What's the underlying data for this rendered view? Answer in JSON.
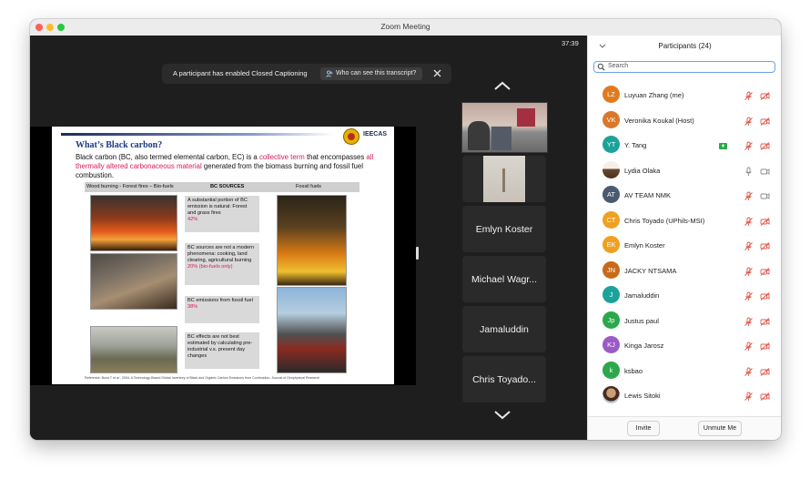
{
  "window": {
    "title": "Zoom Meeting"
  },
  "meeting": {
    "timer": "37:39",
    "cc_banner": {
      "text": "A participant has enabled Closed Captioning",
      "button_label": "Who can see this transcript?"
    }
  },
  "slide": {
    "org": "IEECAS",
    "heading": "What’s Black carbon?",
    "body_part1": "Black carbon (BC, also termed elemental carbon, EC) is a ",
    "body_hl1": "collective term",
    "body_part2": " that encompasses ",
    "body_hl2": "all thermally altered carbonaceous material",
    "body_part3": " generated from the biomass burning and fossil fuel combustion.",
    "table_headers": [
      "Wood burning - Forest fires – Bio-fuels",
      "BC SOURCES",
      "Fossil fuels"
    ],
    "boxes": [
      {
        "text": "A substantial portion of BC emission is natural: Forest and grass fires",
        "pct": "42%"
      },
      {
        "text": "BC sources are not a modern phenomena: cooking, land clearing, agricultural burning",
        "pct": "20% (bio-fuels only)"
      },
      {
        "text": "BC emissions from fossil fuel",
        "pct": "38%"
      },
      {
        "text": "BC effects are not best estimated by calculating pre-industrial v.s. present day changes",
        "pct": ""
      }
    ],
    "reference": "Reference: Bond T et al., 2004: A Technology-Based Global Inventory of Black and Organic Carbon Emissions from Combustion, Journal of Geophysical Research"
  },
  "tiles": [
    "Emlyn Koster",
    "Michael Wagr...",
    "Jamaluddin",
    "Chris Toyado..."
  ],
  "participants_panel": {
    "title": "Participants (24)",
    "search_placeholder": "Search",
    "participants": [
      {
        "initials": "LZ",
        "name": "Luyuan Zhang (me)",
        "color": "#e07a1f",
        "mic": "mic-muted-icon",
        "video": "video-off-icon"
      },
      {
        "initials": "VK",
        "name": "Veronika Koukal (Host)",
        "color": "#d9782a",
        "mic": "mic-muted-icon",
        "video": "video-off-icon"
      },
      {
        "initials": "YT",
        "name": "Y. Tang",
        "color": "#1aa39a",
        "mic": "mic-muted-icon",
        "video": "video-off-icon"
      },
      {
        "initials": "",
        "name": "Lydia Olaka",
        "color": "#8a6a50",
        "mic": "mic-on-icon",
        "video": "video-on-icon"
      },
      {
        "initials": "AT",
        "name": "AV TEAM NMK",
        "color": "#4a5a70",
        "mic": "mic-muted-icon",
        "video": "video-on-icon"
      },
      {
        "initials": "CT",
        "name": "Chris Toyado (UPhils-MSI)",
        "color": "#f0a020",
        "mic": "mic-muted-icon",
        "video": "video-off-icon"
      },
      {
        "initials": "EK",
        "name": "Emlyn Koster",
        "color": "#f0a020",
        "mic": "mic-muted-icon",
        "video": "video-off-icon"
      },
      {
        "initials": "JN",
        "name": "JACKY NTSAMA",
        "color": "#c86a1a",
        "mic": "mic-muted-icon",
        "video": "video-off-icon"
      },
      {
        "initials": "J",
        "name": "Jamaluddin",
        "color": "#1aa39a",
        "mic": "mic-muted-icon",
        "video": "video-off-icon"
      },
      {
        "initials": "Jp",
        "name": "Justus paul",
        "color": "#2aa84a",
        "mic": "mic-muted-icon",
        "video": "video-off-icon"
      },
      {
        "initials": "KJ",
        "name": "Kinga Jarosz",
        "color": "#9a5ac8",
        "mic": "mic-muted-icon",
        "video": "video-off-icon"
      },
      {
        "initials": "k",
        "name": "ksbao",
        "color": "#2aa84a",
        "mic": "mic-muted-icon",
        "video": "video-off-icon"
      },
      {
        "initials": "",
        "name": "Lewis Sitoki",
        "color": "#6a4a30",
        "mic": "mic-muted-icon",
        "video": "video-off-icon"
      }
    ],
    "invite_label": "Invite",
    "unmute_label": "Unmute Me"
  },
  "colors": {
    "muted_red": "#e0584a",
    "accent_blue": "#6aa3e8",
    "share_green": "#2aa84a"
  }
}
